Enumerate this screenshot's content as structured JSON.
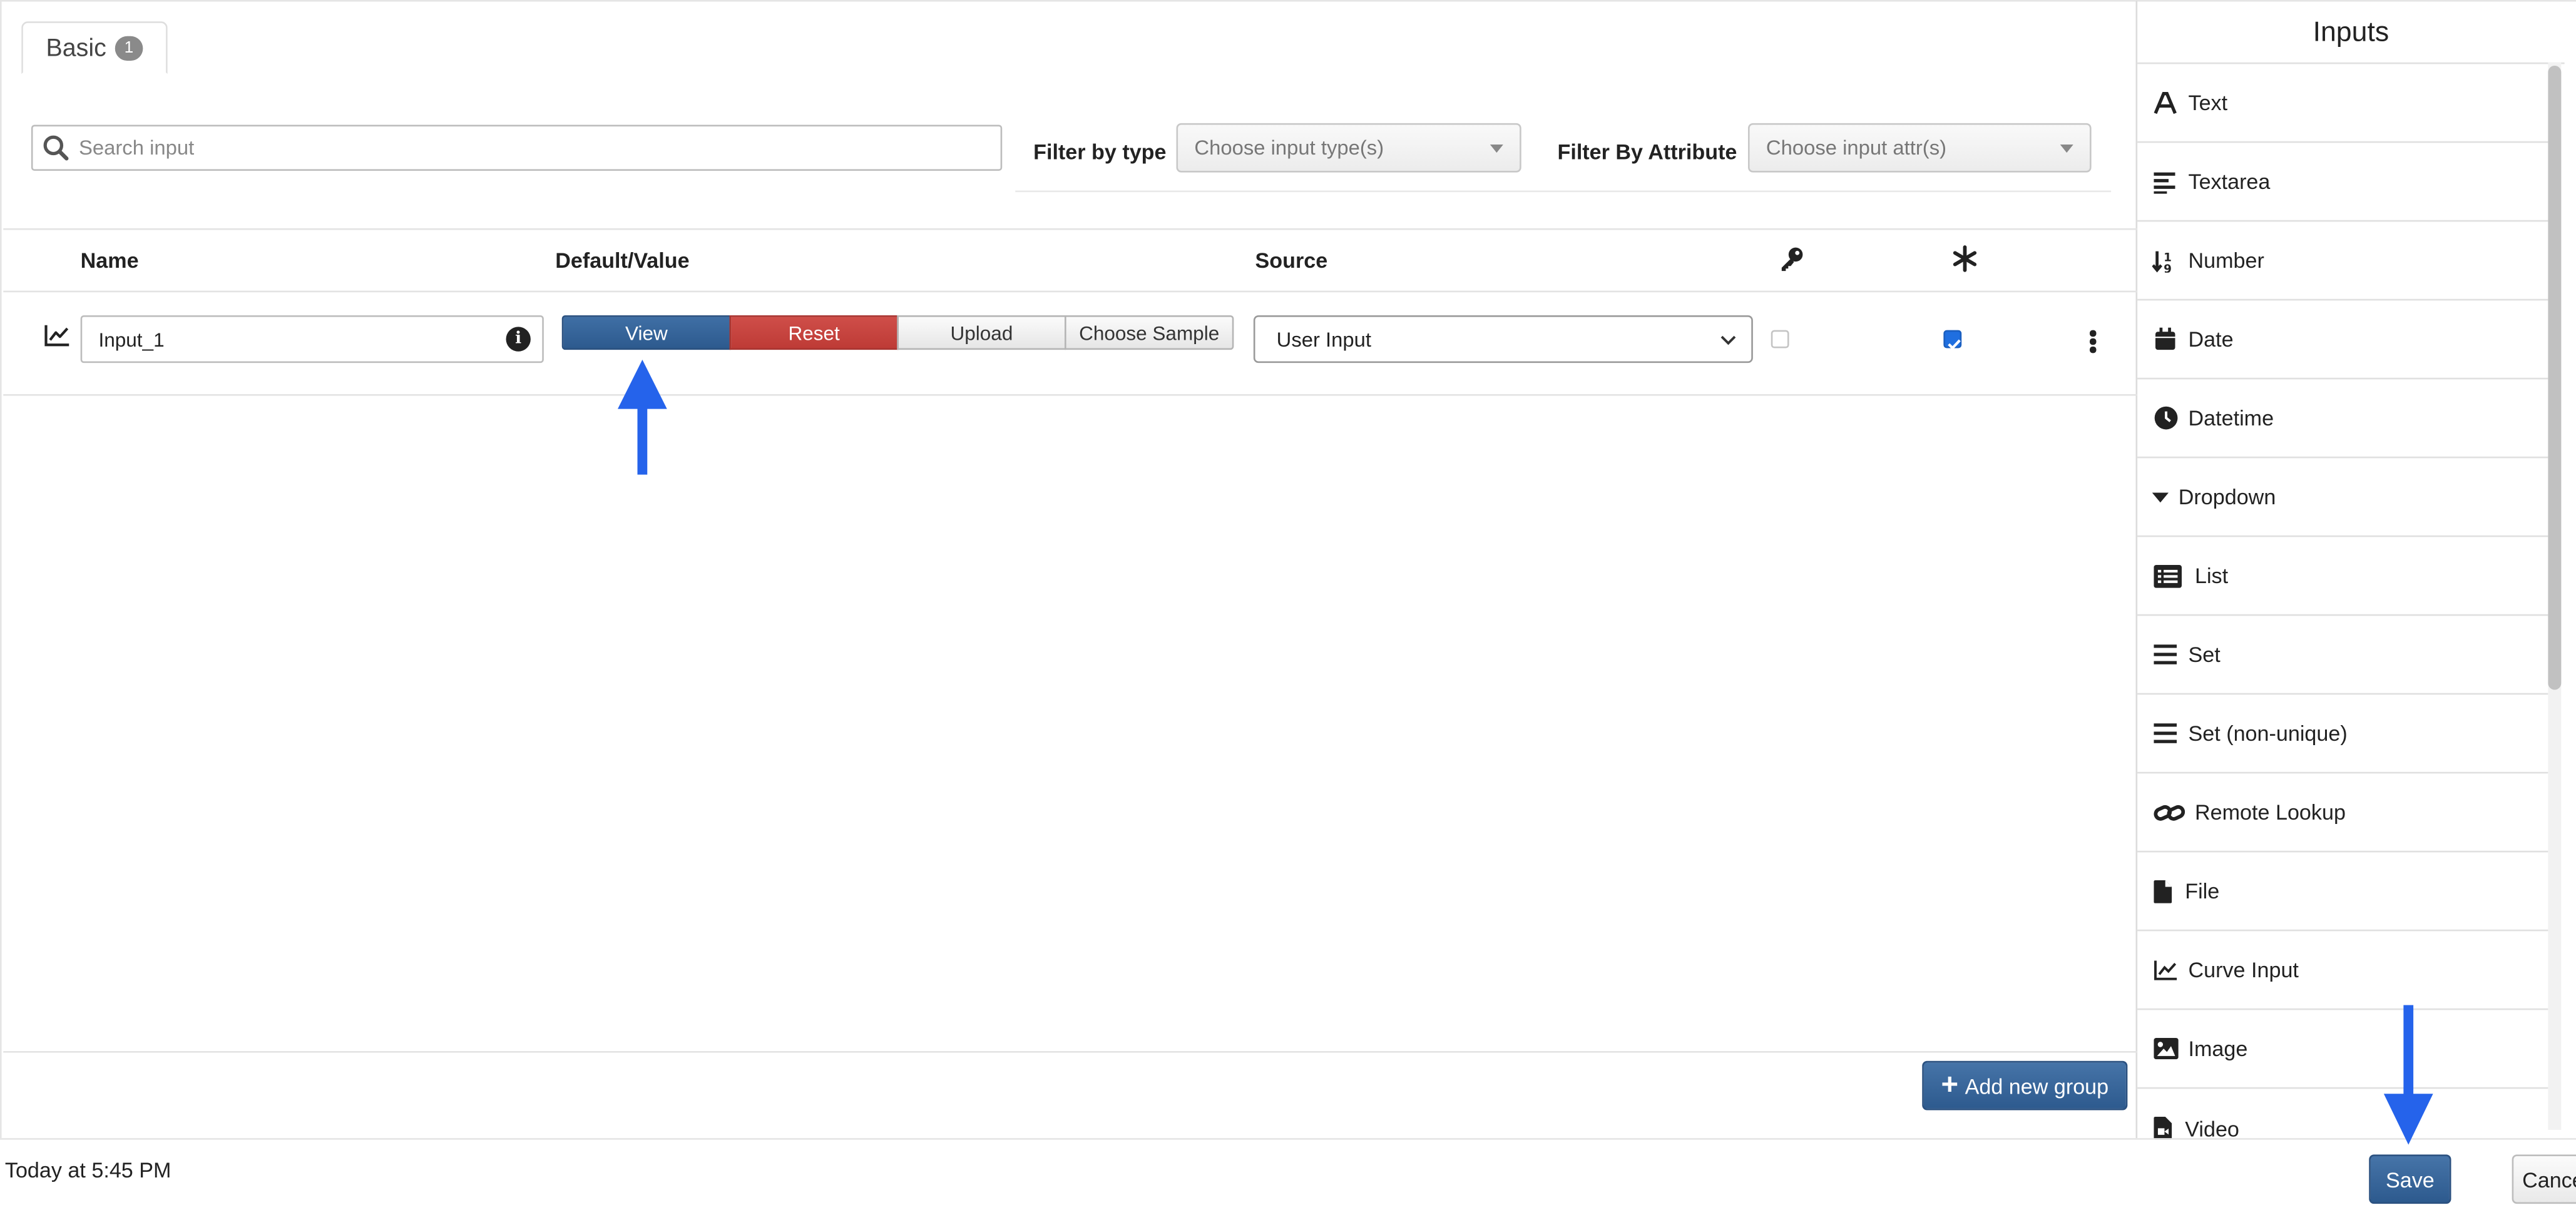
{
  "tab": {
    "label": "Basic",
    "badge": "1"
  },
  "search": {
    "placeholder": "Search input"
  },
  "filters": {
    "type_label": "Filter by type",
    "type_placeholder": "Choose input type(s)",
    "attr_label": "Filter By Attribute",
    "attr_placeholder": "Choose input attr(s)"
  },
  "table": {
    "headers": {
      "name": "Name",
      "value": "Default/Value",
      "source": "Source",
      "key_icon": "key-icon",
      "required_icon": "asterisk-icon"
    },
    "rows": [
      {
        "name": "Input_1",
        "buttons": {
          "view": "View",
          "reset": "Reset",
          "upload": "Upload",
          "sample": "Choose Sample"
        },
        "source": "User Input",
        "key_checked": false,
        "required_checked": true
      }
    ]
  },
  "add_group_label": "Add new group",
  "inputs_panel": {
    "title": "Inputs",
    "items": [
      {
        "label": "Text",
        "icon": "text-icon"
      },
      {
        "label": "Textarea",
        "icon": "textarea-icon"
      },
      {
        "label": "Number",
        "icon": "number-icon"
      },
      {
        "label": "Date",
        "icon": "calendar-icon"
      },
      {
        "label": "Datetime",
        "icon": "clock-icon"
      },
      {
        "label": "Dropdown",
        "icon": "caret-down-icon"
      },
      {
        "label": "List",
        "icon": "list-icon"
      },
      {
        "label": "Set",
        "icon": "bars-icon"
      },
      {
        "label": "Set (non-unique)",
        "icon": "bars-icon"
      },
      {
        "label": "Remote Lookup",
        "icon": "link-icon"
      },
      {
        "label": "File",
        "icon": "file-icon"
      },
      {
        "label": "Curve Input",
        "icon": "chart-line-icon"
      },
      {
        "label": "Image",
        "icon": "image-icon"
      },
      {
        "label": "Video",
        "icon": "video-file-icon"
      }
    ]
  },
  "footer": {
    "timestamp": "Today at 5:45 PM",
    "save": "Save",
    "cancel": "Cancel"
  },
  "colors": {
    "primary": "#2d5a8e",
    "danger": "#be3b36",
    "annotation_arrow": "#2563eb",
    "checkbox": "#1f6fe0"
  }
}
